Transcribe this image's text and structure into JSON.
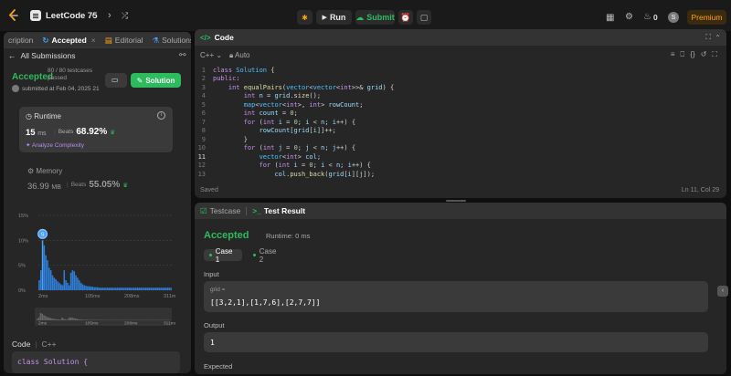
{
  "topbar": {
    "title": "LeetCode 75",
    "run": "Run",
    "submit": "Submit",
    "streak": "0",
    "avatar_letter": "S",
    "premium": "Premium"
  },
  "left": {
    "tabs": [
      "cription",
      "Accepted",
      "Editorial",
      "Solutions"
    ],
    "all_submissions": "All Submissions",
    "status": "Accepted",
    "testcases": "80 / 80 testcases passed",
    "submitted": "submitted at Feb 04, 2025 21",
    "solution_btn": "Solution",
    "runtime_label": "Runtime",
    "runtime_val": "15",
    "runtime_unit": "ms",
    "beats_label": "Beats",
    "runtime_beats": "68.92%",
    "analyze": "Analyze Complexity",
    "memory_label": "Memory",
    "memory_val": "36.99",
    "memory_unit": "MB",
    "memory_beats": "55.05%",
    "code_label": "Code",
    "code_lang": "C++",
    "code_snip": "class Solution {"
  },
  "chart_data": {
    "type": "bar",
    "x": [
      "2ms",
      "105ms",
      "208ms",
      "311ms"
    ],
    "y_ticks": [
      "15%",
      "10%",
      "5%",
      "0%"
    ],
    "ylim": [
      0,
      15
    ],
    "values": [
      2,
      4,
      10,
      9,
      7,
      6,
      4.5,
      4,
      3,
      2.5,
      2.2,
      1.8,
      1.5,
      1.2,
      1,
      4,
      2,
      1.5,
      1,
      3.5,
      4,
      3.8,
      3,
      2.5,
      2,
      1.5,
      1.2,
      1,
      0.9,
      0.8,
      0.8,
      0.7,
      0.7,
      0.6,
      0.6,
      0.6,
      0.5,
      0.5,
      0.5,
      0.5,
      0.5,
      0.5,
      0.5,
      0.5,
      0.5,
      0.5,
      0.5,
      0.5,
      0.5,
      0.5,
      0.5,
      0.5,
      0.5,
      0.5,
      0.5,
      0.5,
      0.5,
      0.5,
      0.5,
      0.5,
      0.5,
      0.5,
      0.5,
      0.5,
      0.5,
      0.5,
      0.5,
      0.5,
      0.5,
      0.5,
      0.5,
      0.5,
      0.5,
      0.5,
      0.5,
      0.5,
      0.5,
      0.5,
      0.5,
      0.5
    ],
    "highlight_index": 2,
    "marker_letter": "S",
    "bar_color": "#2f7fd9",
    "highlight_color": "#4aa3ff"
  },
  "code": {
    "title": "Code",
    "lang": "C++",
    "auto": "Auto",
    "saved": "Saved",
    "lncol": "Ln 11, Col 29"
  },
  "result": {
    "tabs": [
      "Testcase",
      "Test Result"
    ],
    "status": "Accepted",
    "runtime": "Runtime: 0 ms",
    "case1": "Case 1",
    "case2": "Case 2",
    "input_label": "Input",
    "input_var": "grid =",
    "input_val": "[[3,2,1],[1,7,6],[2,7,7]]",
    "output_label": "Output",
    "output_val": "1",
    "expected_label": "Expected"
  }
}
